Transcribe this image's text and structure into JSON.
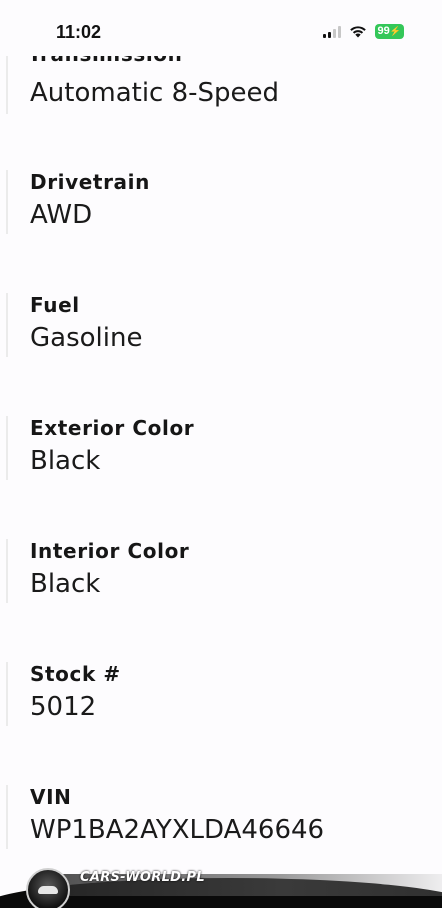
{
  "status_bar": {
    "time": "11:02",
    "battery": "99"
  },
  "specs": {
    "partial_label": "Transmission",
    "items": [
      {
        "label": "",
        "value": "Automatic 8-Speed"
      },
      {
        "label": "Drivetrain",
        "value": "AWD"
      },
      {
        "label": "Fuel",
        "value": "Gasoline"
      },
      {
        "label": "Exterior Color",
        "value": "Black"
      },
      {
        "label": "Interior Color",
        "value": "Black"
      },
      {
        "label": "Stock #",
        "value": "5012"
      },
      {
        "label": "VIN",
        "value": "WP1BA2AYXLDA46646"
      }
    ]
  },
  "watermark": {
    "text": "CARS-WORLD.PL"
  }
}
